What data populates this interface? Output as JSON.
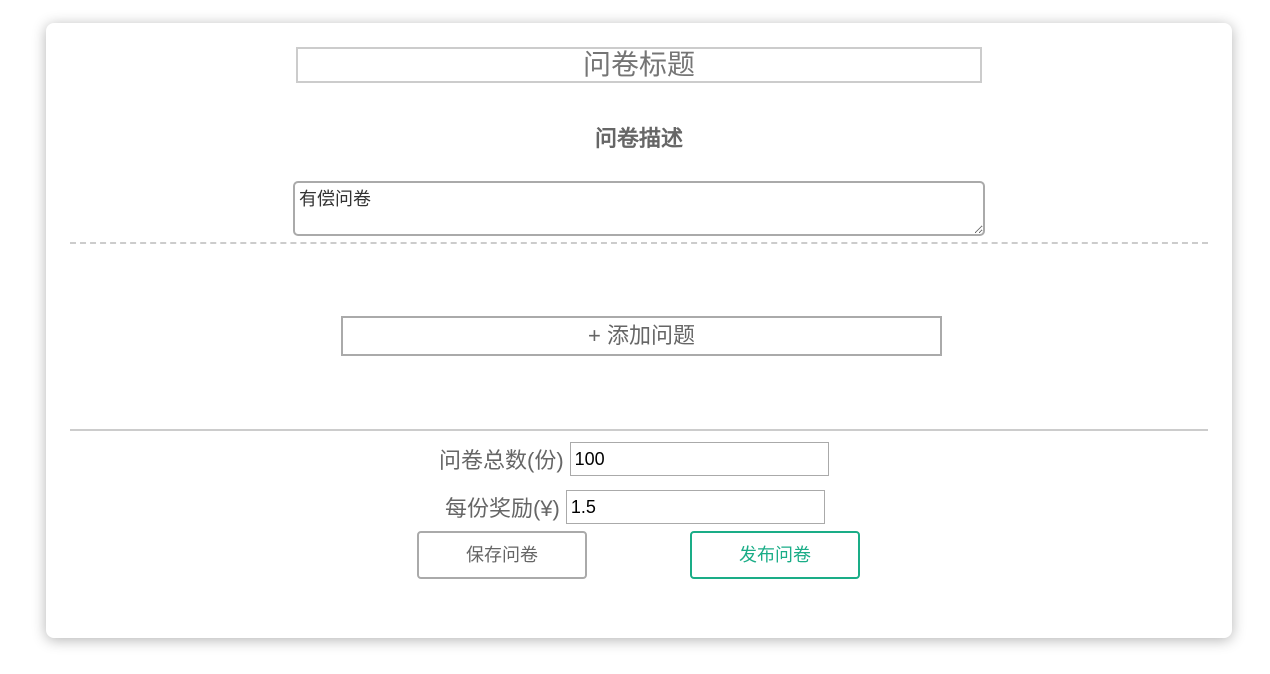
{
  "survey": {
    "title_placeholder": "问卷标题",
    "description_label": "问卷描述",
    "description_value": "有偿问卷",
    "add_question_label": "+ 添加问题",
    "total_count_label": "问卷总数(份)",
    "total_count_value": "100",
    "reward_label": "每份奖励(¥)",
    "reward_value": "1.5",
    "save_label": "保存问卷",
    "publish_label": "发布问卷"
  },
  "colors": {
    "accent": "#1aad87",
    "border": "#aaaaaa"
  }
}
